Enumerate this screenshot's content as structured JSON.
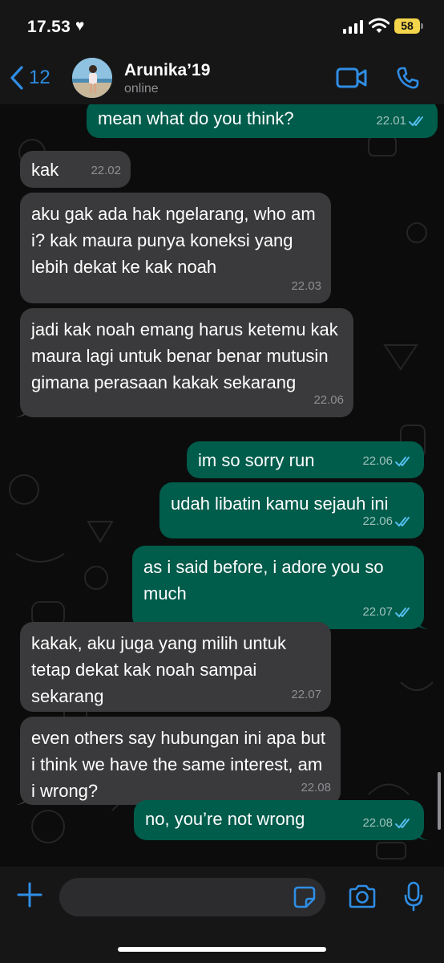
{
  "status_bar": {
    "time": "17.53",
    "battery": "58"
  },
  "header": {
    "back_count": "12",
    "contact_name": "Arunika’19",
    "contact_status": "online"
  },
  "messages": [
    {
      "direction": "out",
      "text": "mean what do you think?",
      "time": "22.01",
      "read": true
    },
    {
      "direction": "in",
      "text": "kak",
      "time": "22.02"
    },
    {
      "direction": "in",
      "text": "aku gak ada hak ngelarang, who am i? kak maura punya koneksi yang lebih dekat ke kak noah",
      "time": "22.03"
    },
    {
      "direction": "in",
      "text": "jadi kak noah emang harus ketemu kak maura lagi untuk benar benar mutusin gimana perasaan kakak sekarang",
      "time": "22.06"
    },
    {
      "direction": "out",
      "text": "im so sorry run",
      "time": "22.06",
      "read": true
    },
    {
      "direction": "out",
      "text": "udah libatin kamu sejauh ini",
      "time": "22.06",
      "read": true
    },
    {
      "direction": "out",
      "text": "as i said before, i adore you so much",
      "time": "22.07",
      "read": true
    },
    {
      "direction": "in",
      "text": "kakak, aku juga yang milih untuk tetap dekat kak noah sampai sekarang",
      "time": "22.07"
    },
    {
      "direction": "in",
      "text": "even others say hubungan ini apa but i think we have the same interest, am i wrong?",
      "time": "22.08"
    },
    {
      "direction": "out",
      "text": "no, you’re not wrong",
      "time": "22.08",
      "read": true
    }
  ],
  "input": {
    "placeholder": ""
  },
  "icons": {
    "back": "chevron-left-icon",
    "video": "video-camera-icon",
    "phone": "phone-icon",
    "plus": "plus-icon",
    "sticker": "sticker-icon",
    "camera": "camera-icon",
    "mic": "microphone-icon",
    "read": "double-check-icon"
  },
  "colors": {
    "accent": "#2f8de4",
    "incoming_bubble": "#3a3a3c",
    "outgoing_bubble": "#005c4b",
    "read_tick": "#53bdeb",
    "battery": "#f3d44b"
  }
}
